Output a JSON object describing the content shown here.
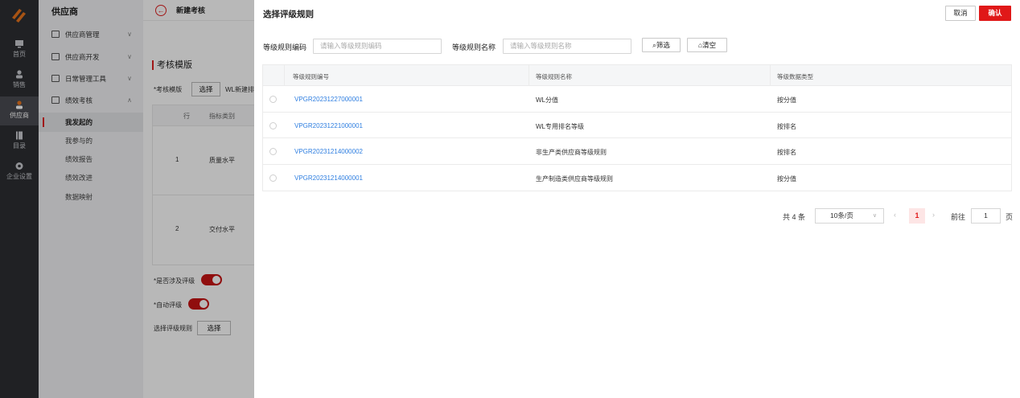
{
  "rail": {
    "items": [
      {
        "label": "首页",
        "icon": "monitor-icon"
      },
      {
        "label": "销售",
        "icon": "person-icon"
      },
      {
        "label": "供应商",
        "icon": "person-icon"
      },
      {
        "label": "目录",
        "icon": "book-icon"
      },
      {
        "label": "企业设置",
        "icon": "gear-icon"
      }
    ],
    "active": "供应商"
  },
  "sidebar": {
    "title": "供应商",
    "groups": [
      {
        "label": "供应商管理",
        "arrow": "∨"
      },
      {
        "label": "供应商开发",
        "arrow": "∨"
      },
      {
        "label": "日常管理工具",
        "arrow": "∨"
      },
      {
        "label": "绩效考核",
        "arrow": "∧"
      }
    ],
    "sub_items": [
      "我发起的",
      "我参与的",
      "绩效报告",
      "绩效改进",
      "数据映射"
    ]
  },
  "main": {
    "back": "←",
    "page_title": "新建考核",
    "section_title": "考核模版",
    "template_label": "*考核模版",
    "select_label": "选择",
    "template_value": "WL新建排",
    "table": {
      "headers": [
        "行",
        "指标类别"
      ],
      "rows": [
        [
          "1",
          "质量水平"
        ],
        [
          "2",
          "交付水平"
        ]
      ]
    },
    "rating_label": "*是否涉及评级",
    "auto_label": "*自动评级",
    "rule_label": "选择评级规则",
    "rule_select": "选择"
  },
  "drawer": {
    "title": "选择评级规则",
    "cancel": "取消",
    "confirm": "确认",
    "filter": {
      "code_label": "等级规则编码",
      "code_placeholder": "请输入等级规则编码",
      "name_label": "等级规则名称",
      "name_placeholder": "请输入等级规则名称",
      "search_btn": "筛选",
      "clear_btn": "清空"
    },
    "table": {
      "headers": [
        "等级规则编号",
        "等级规则名称",
        "等级数据类型"
      ],
      "rows": [
        {
          "code": "VPGR20231227000001",
          "name": "WL分值",
          "type": "按分值"
        },
        {
          "code": "VPGR20231221000001",
          "name": "WL专用排名等级",
          "type": "按排名"
        },
        {
          "code": "VPGR20231214000002",
          "name": "非生产类供应商等级规则",
          "type": "按排名"
        },
        {
          "code": "VPGR20231214000001",
          "name": "生产制造类供应商等级规则",
          "type": "按分值"
        }
      ]
    },
    "pagination": {
      "total": "共 4 条",
      "page_size": "10条/页",
      "prev": "‹",
      "current": "1",
      "next": "›",
      "goto_label": "前往",
      "goto_value": "1",
      "page_suffix": "页"
    }
  },
  "colors": {
    "accent": "#e01818",
    "link": "#2e7ee0",
    "rail_bg": "#2d2f33"
  }
}
